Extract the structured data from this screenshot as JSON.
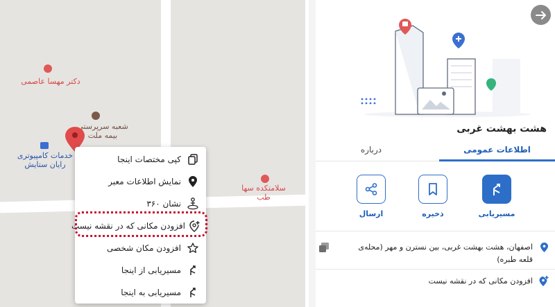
{
  "map": {
    "poi_dentist": "دکتر مهسا عاصمی",
    "poi_insurance": "شعبه سرپرستی\nبیمه ملت",
    "poi_computer": "خدمات کامپیوتری\nرایان ستایش",
    "poi_clinic": "سلامتکده سها\nطب"
  },
  "context_menu": {
    "items": [
      {
        "label": "کپی مختصات اینجا",
        "icon": "copy-icon"
      },
      {
        "label": "نمایش اطلاعات معبر",
        "icon": "location-pin-icon"
      },
      {
        "label": "نشان ۳۶۰",
        "icon": "person-360-icon"
      },
      {
        "label": "افزودن مکانی که در نقشه نیست",
        "icon": "add-location-icon"
      },
      {
        "label": "افزودن مکان شخصی",
        "icon": "star-icon"
      },
      {
        "label": "مسیریابی از اینجا",
        "icon": "route-icon"
      },
      {
        "label": "مسیریابی به اینجا",
        "icon": "route-icon"
      }
    ]
  },
  "panel": {
    "title": "هشت بهشت غربی",
    "tabs": {
      "general": "اطلاعات عمومی",
      "about": "درباره"
    },
    "actions": {
      "route": "مسیریابی",
      "save": "ذخیره",
      "share": "ارسال"
    },
    "address": "اصفهان، هشت بهشت غربی، بین نسترن و مهر (محله‌ی قلعه طبره)",
    "add_place": "افزودن مکانی که در نقشه نیست"
  },
  "colors": {
    "accent": "#2d6ec8",
    "highlight": "#c8102e",
    "pin": "#e04a4a"
  }
}
